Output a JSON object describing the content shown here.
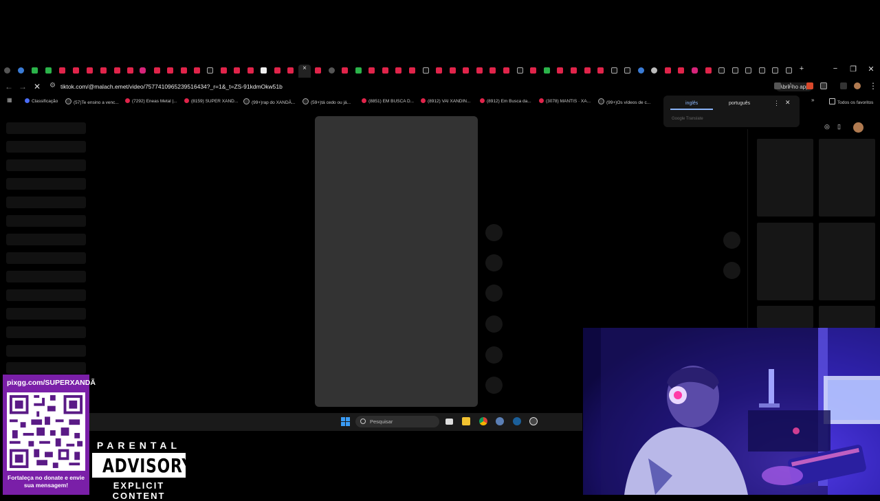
{
  "browser": {
    "url": "tiktok.com/@malach.emet/video/7577410965239516434?_r=1&_t=ZS-91kdmOkw51b",
    "open_app_label": "Abrir no app"
  },
  "bookmarks": {
    "items": [
      "Classificação",
      "(57)Te ensino a venc...",
      "(7292) Eneas Metal |...",
      "(8159) SUPER XAND...",
      "(99+)rap do XANDÃ...",
      "(59+)tá cedo ou já...",
      "(8851) EM BUSCA D...",
      "(8912) VAI XANDIN...",
      "(8912) Em Busca da...",
      "(3078) MANTIS · XA...",
      "(99+)Os vídeos de c..."
    ],
    "all_favorites_label": "Todos os favoritos"
  },
  "translate_popup": {
    "source_language": "inglês",
    "target_language": "português",
    "brand": "Google Translate"
  },
  "taskbar": {
    "search_placeholder": "Pesquisar"
  },
  "donation": {
    "url": "pixgg.com/SUPERXANDÃ",
    "message": "Fortaleça no donate e envie sua mensagem!"
  },
  "parental_advisory": {
    "line1": "PARENTAL",
    "line2": "ADVISORY",
    "line3": "EXPLICIT CONTENT"
  },
  "colors": {
    "accent_blue": "#8ab4f8",
    "youtube_red": "#e0244a",
    "donate_purple": "#7a1fa8"
  }
}
